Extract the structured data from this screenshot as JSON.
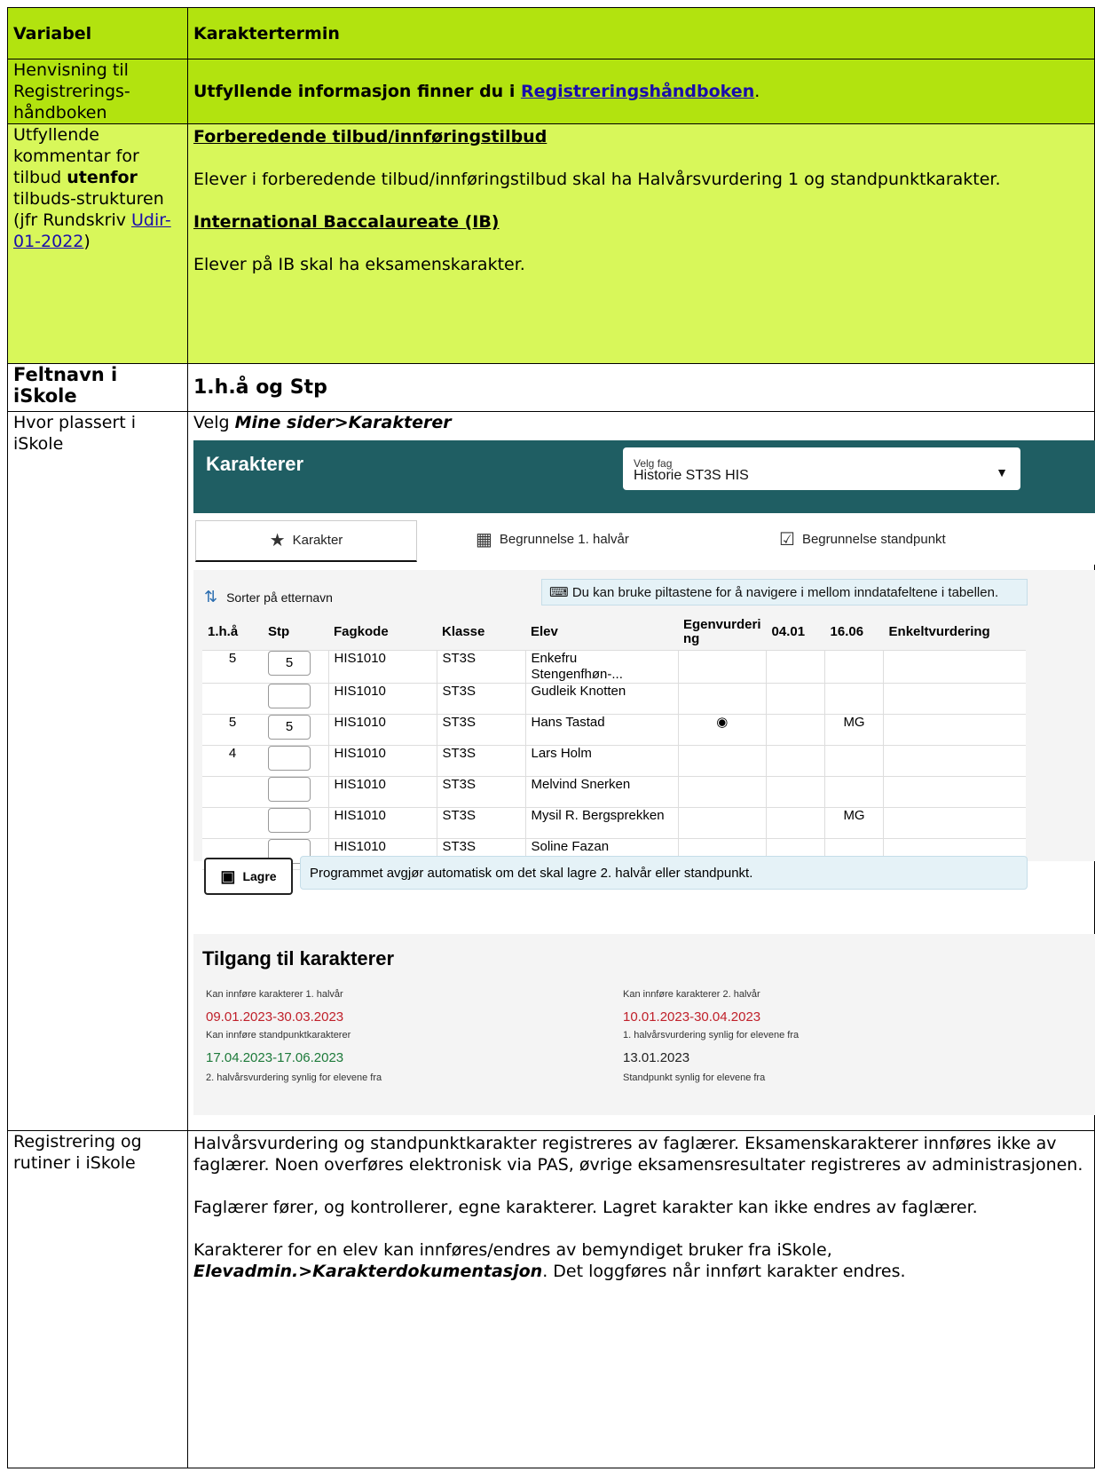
{
  "header": {
    "variable_label": "Variabel",
    "title": "Karaktertermin"
  },
  "row_ref": {
    "label": "Henvisning til Registrerings-håndboken",
    "text_prefix": "Utfyllende informasjon finner du i ",
    "link": "Registreringshåndboken",
    "text_suffix": "."
  },
  "row_comment": {
    "label_1": "Utfyllende kommentar for tilbud ",
    "label_bold": "utenfor",
    "label_2": " tilbuds-strukturen (jfr Rundskriv ",
    "label_link": "Udir-01-2022",
    "label_3": ")",
    "heading_1": "Forberedende tilbud/innføringstilbud",
    "text_1": "Elever i forberedende tilbud/innføringstilbud skal ha Halvårsvurdering 1 og standpunktkarakter.",
    "heading_2": "International Baccalaureate (IB)",
    "text_2": "Elever på IB skal ha eksamenskarakter."
  },
  "row_field": {
    "label": "Feltnavn i iSkole",
    "value": "1.h.å og Stp"
  },
  "row_location": {
    "label": "Hvor plassert i iSkole",
    "text_prefix": "Velg ",
    "path": "Mine sider>Karakterer"
  },
  "screenshot": {
    "title": "Karakterer",
    "select_label": "Velg fag",
    "select_value": "Historie ST3S HIS",
    "tabs": [
      "Karakter",
      "Begrunnelse 1. halvår",
      "Begrunnelse standpunkt"
    ],
    "sort_label": "Sorter på etternavn",
    "hint": "Du kan bruke piltastene for å navigere i mellom inndatafeltene i tabellen.",
    "columns": [
      "1.h.å",
      "Stp",
      "Fagkode",
      "Klasse",
      "Elev",
      "Egenvurderi ng",
      "04.01",
      "16.06",
      "Enkeltvurdering"
    ],
    "rows": [
      {
        "h1": "5",
        "stp": "5",
        "fag": "HIS1010",
        "klasse": "ST3S",
        "elev": "Enkefru Stengenfhøn-...",
        "egen": "",
        "d1": "",
        "d2": "",
        "enk": ""
      },
      {
        "h1": "",
        "stp": "",
        "fag": "HIS1010",
        "klasse": "ST3S",
        "elev": "Gudleik Knotten",
        "egen": "",
        "d1": "",
        "d2": "",
        "enk": ""
      },
      {
        "h1": "5",
        "stp": "5",
        "fag": "HIS1010",
        "klasse": "ST3S",
        "elev": "Hans Tastad",
        "egen": "◉",
        "d1": "",
        "d2": "MG",
        "enk": ""
      },
      {
        "h1": "4",
        "stp": "",
        "fag": "HIS1010",
        "klasse": "ST3S",
        "elev": "Lars Holm",
        "egen": "",
        "d1": "",
        "d2": "",
        "enk": ""
      },
      {
        "h1": "",
        "stp": "",
        "fag": "HIS1010",
        "klasse": "ST3S",
        "elev": "Melvind Snerken",
        "egen": "",
        "d1": "",
        "d2": "",
        "enk": ""
      },
      {
        "h1": "",
        "stp": "",
        "fag": "HIS1010",
        "klasse": "ST3S",
        "elev": "Mysil R. Bergsprekken",
        "egen": "",
        "d1": "",
        "d2": "MG",
        "enk": ""
      },
      {
        "h1": "",
        "stp": "",
        "fag": "HIS1010",
        "klasse": "ST3S",
        "elev": "Soline Fazan",
        "egen": "",
        "d1": "",
        "d2": "",
        "enk": ""
      }
    ],
    "save_label": "Lagre",
    "save_info": "Programmet avgjør automatisk om det skal lagre 2. halvår eller standpunkt.",
    "access_title": "Tilgang til karakterer",
    "access": [
      {
        "label": "Kan innføre karakterer 1. halvår",
        "value": "09.01.2023-30.03.2023"
      },
      {
        "label": "Kan innføre karakterer 2. halvår",
        "value": "10.01.2023-30.04.2023"
      },
      {
        "label": "Kan innføre standpunktkarakterer",
        "value": "17.04.2023-17.06.2023"
      },
      {
        "label": "1. halvårsvurdering synlig for elevene fra",
        "value": "13.01.2023"
      },
      {
        "label": "2. halvårsvurdering synlig for elevene fra",
        "value": ""
      },
      {
        "label": "Standpunkt synlig for elevene fra",
        "value": ""
      }
    ],
    "colors": {
      "header": "#1f5e63",
      "red": "#c0202a",
      "green": "#1d7a3a"
    }
  },
  "row_registration": {
    "label": "Registrering og rutiner i iSkole",
    "p1": "Halvårsvurdering og standpunktkarakter registreres av faglærer. Eksamenskarakterer innføres ikke av faglærer. Noen overføres elektronisk via PAS, øvrige eksamensresultater registreres av administrasjonen.",
    "p2": "Faglærer fører, og kontrollerer, egne karakterer. Lagret karakter kan ikke endres av faglærer.",
    "p3_prefix": "Karakterer for en elev kan innføres/endres av bemyndiget bruker fra iSkole, ",
    "p3_path": "Elevadmin.>Karakterdokumentasjon",
    "p3_suffix": ". Det loggføres når innført karakter endres."
  }
}
